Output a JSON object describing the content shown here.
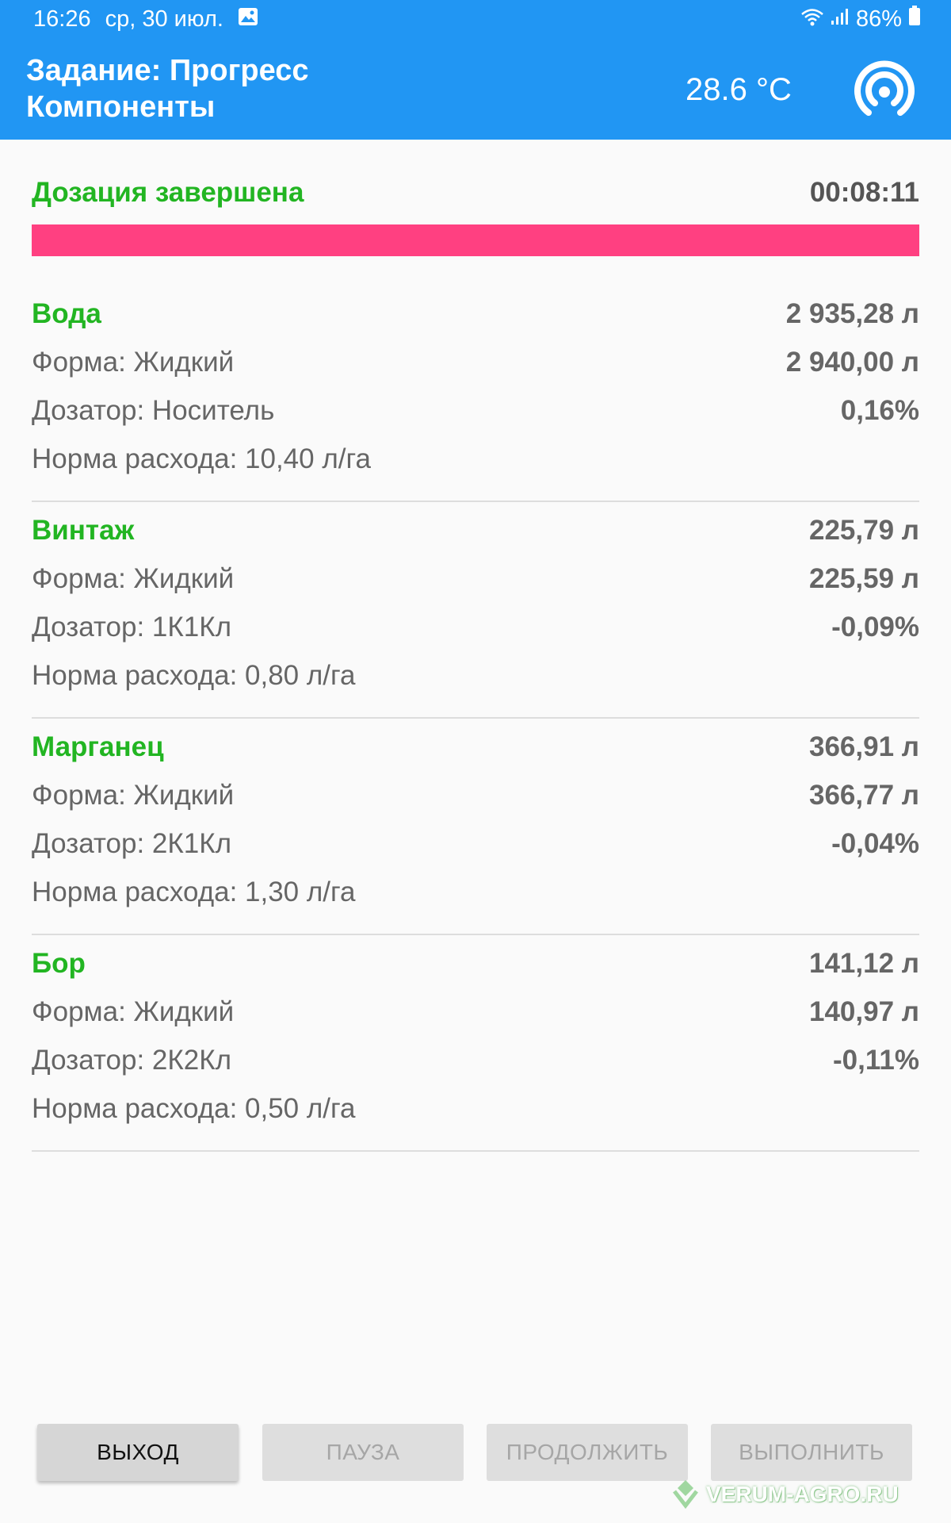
{
  "status_bar": {
    "time": "16:26",
    "date": "ср, 30 июл.",
    "battery": "86%"
  },
  "header": {
    "title_line1": "Задание: Прогресс",
    "title_line2": "Компоненты",
    "temperature": "28.6 °C",
    "background_color": "#2196f3"
  },
  "progress": {
    "status": "Дозация завершена",
    "elapsed": "00:08:11",
    "fill_fraction": 1.0,
    "fill_color": "#ff4081"
  },
  "components": [
    {
      "name": "Вода",
      "applied": "2 935,28 л",
      "form": "Форма: Жидкий",
      "target": "2 940,00 л",
      "doser": "Дозатор: Носитель",
      "deviation": "0,16%",
      "rate": "Норма расхода: 10,40 л/га"
    },
    {
      "name": "Винтаж",
      "applied": "225,79 л",
      "form": "Форма: Жидкий",
      "target": "225,59 л",
      "doser": "Дозатор: 1К1Кл",
      "deviation": "-0,09%",
      "rate": "Норма расхода: 0,80 л/га"
    },
    {
      "name": "Марганец",
      "applied": "366,91 л",
      "form": "Форма: Жидкий",
      "target": "366,77 л",
      "doser": "Дозатор: 2К1Кл",
      "deviation": "-0,04%",
      "rate": "Норма расхода: 1,30 л/га"
    },
    {
      "name": "Бор",
      "applied": "141,12 л",
      "form": "Форма: Жидкий",
      "target": "140,97 л",
      "doser": "Дозатор: 2К2Кл",
      "deviation": "-0,11%",
      "rate": "Норма расхода: 0,50 л/га"
    }
  ],
  "buttons": {
    "exit": "ВЫХОД",
    "pause": "ПАУЗА",
    "resume": "ПРОДОЛЖИТЬ",
    "execute": "ВЫПОЛНИТЬ"
  },
  "watermark": "VERUM-AGRO.RU",
  "colors": {
    "component_name": "#22b522",
    "text_secondary": "#666666"
  }
}
